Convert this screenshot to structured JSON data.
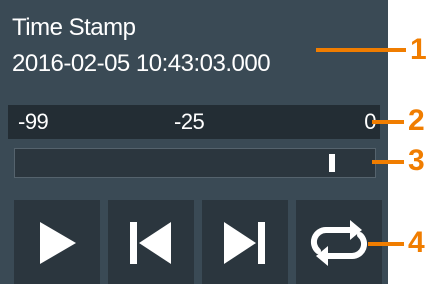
{
  "timestamp": {
    "label": "Time Stamp",
    "value": "2016-02-05 10:43:03.000"
  },
  "scale": {
    "min_label": "-99",
    "mid_label": "-25",
    "max_label": "0",
    "min": -99,
    "max": 0
  },
  "slider": {
    "value": -8
  },
  "buttons": {
    "play": "play-icon",
    "previous": "skip-previous-icon",
    "next": "skip-next-icon",
    "loop": "repeat-icon"
  },
  "callouts": {
    "c1": "1",
    "c2": "2",
    "c3": "3",
    "c4": "4"
  },
  "colors": {
    "panel": "#3a4a55",
    "dark": "#232d34",
    "accent": "#f07d00"
  }
}
